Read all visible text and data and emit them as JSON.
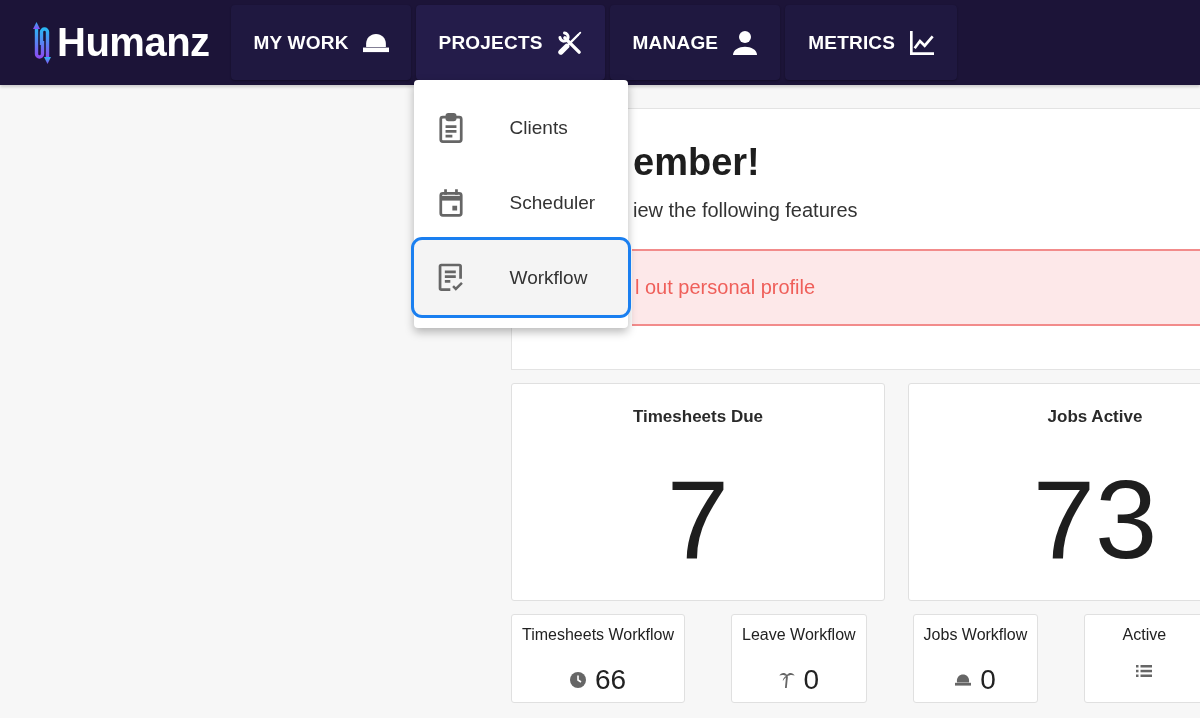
{
  "top_bar": {
    "logo": "Humanz",
    "nav": [
      {
        "label": "MY WORK",
        "expanded": false
      },
      {
        "label": "PROJECTS",
        "expanded": true,
        "menu": [
          {
            "label": "Clients",
            "selected": false
          },
          {
            "label": "Scheduler",
            "selected": false
          },
          {
            "label": "Workflow",
            "selected": true
          }
        ]
      },
      {
        "label": "MANAGE",
        "expanded": false
      },
      {
        "label": "METRICS",
        "expanded": false
      }
    ]
  },
  "welcome": {
    "heading": "ember!",
    "subtitle": "iew the following features",
    "alert": "l out personal profile"
  },
  "stat_cards": [
    {
      "title": "Timesheets Due",
      "value": "7"
    },
    {
      "title": "Jobs Active",
      "value": "73"
    }
  ],
  "workflow_cards": [
    {
      "title": "Timesheets Workflow",
      "value": "66"
    },
    {
      "title": "Leave Workflow",
      "value": "0"
    },
    {
      "title": "Jobs Workflow",
      "value": "0"
    },
    {
      "title": "Active"
    }
  ]
}
